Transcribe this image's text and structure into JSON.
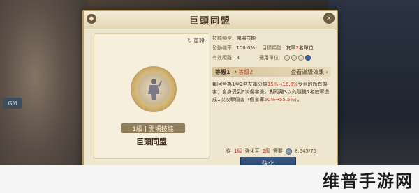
{
  "side": {
    "label": "GM"
  },
  "dialog": {
    "title": "巨頭同盟",
    "reset_label": "重設",
    "skill": {
      "level_tag": "1級 | 開場技能",
      "name": "巨頭同盟"
    },
    "info": {
      "type_key": "技能類型:",
      "type_val": "開場技能",
      "rate_key": "發動機率:",
      "rate_val": "100.0%",
      "target_key": "目標類型:",
      "target_val_pre": "友軍",
      "target_val_hl": "2",
      "target_val_post": "名單位",
      "range_key": "有效距離:",
      "range_val": "3",
      "unit_key": "適用單位:"
    },
    "level_bar": {
      "from": "等級1",
      "arrow": "→",
      "to": "等級2",
      "link": "查看滿級效果 ›"
    },
    "desc": {
      "p1": "每回合為1至2名友軍分擔",
      "p1_hl": "15%→16.6%",
      "p2": "受到的所有傷害；自身受到6次傷害後，對距離3以內隨機1名敵軍造成1次攻擊傷害（傷害率",
      "p2_hl": "50%→55.5%",
      "p3": "）。"
    },
    "cost": {
      "pre": "從",
      "from": "1級",
      "mid": "強化至",
      "to": "2級",
      "post": "需要",
      "amount": "8,645/75"
    },
    "enhance_label": "強化",
    "close_icon": "×"
  },
  "watermark": {
    "text": "维普手游网"
  },
  "colors": {
    "accent_red": "#b23b2a",
    "button_blue": "#2f4d78",
    "panel_bg": "#efe6cf"
  }
}
